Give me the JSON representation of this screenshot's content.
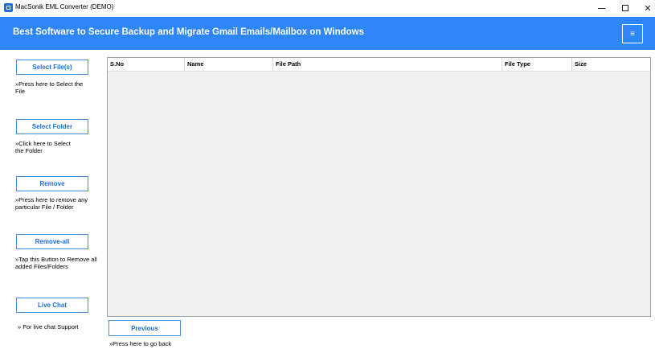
{
  "window": {
    "title": "MacSonik EML Converter (DEMO)",
    "minimize_symbol": "",
    "close_symbol": "✕"
  },
  "banner": {
    "title": "Best Software to Secure Backup and Migrate Gmail Emails/Mailbox on Windows",
    "menu_symbol": "≡",
    "color": "#2f86f6"
  },
  "sidebar": {
    "items": [
      {
        "label": "Select File(s)",
        "hint": "»Press here to Select the File"
      },
      {
        "label": "Select Folder",
        "hint": "»Click here to Select the Folder"
      },
      {
        "label": "Remove",
        "hint": "»Press here to remove any particular File / Folder"
      },
      {
        "label": "Remove-all",
        "hint": "»Tap this Button to Remove all added Files/Folders"
      },
      {
        "label": "Live Chat",
        "hint": "» For live chat Support"
      }
    ]
  },
  "table": {
    "columns": [
      "S.No",
      "Name",
      "File Path",
      "File Type",
      "Size"
    ],
    "rows": []
  },
  "footer": {
    "previous_label": "Previous",
    "previous_hint": "»Press here to go back"
  },
  "colors": {
    "accent": "#1e6fd9",
    "button_border": "#4a8fdc",
    "table_bg": "#f0f0f0"
  }
}
